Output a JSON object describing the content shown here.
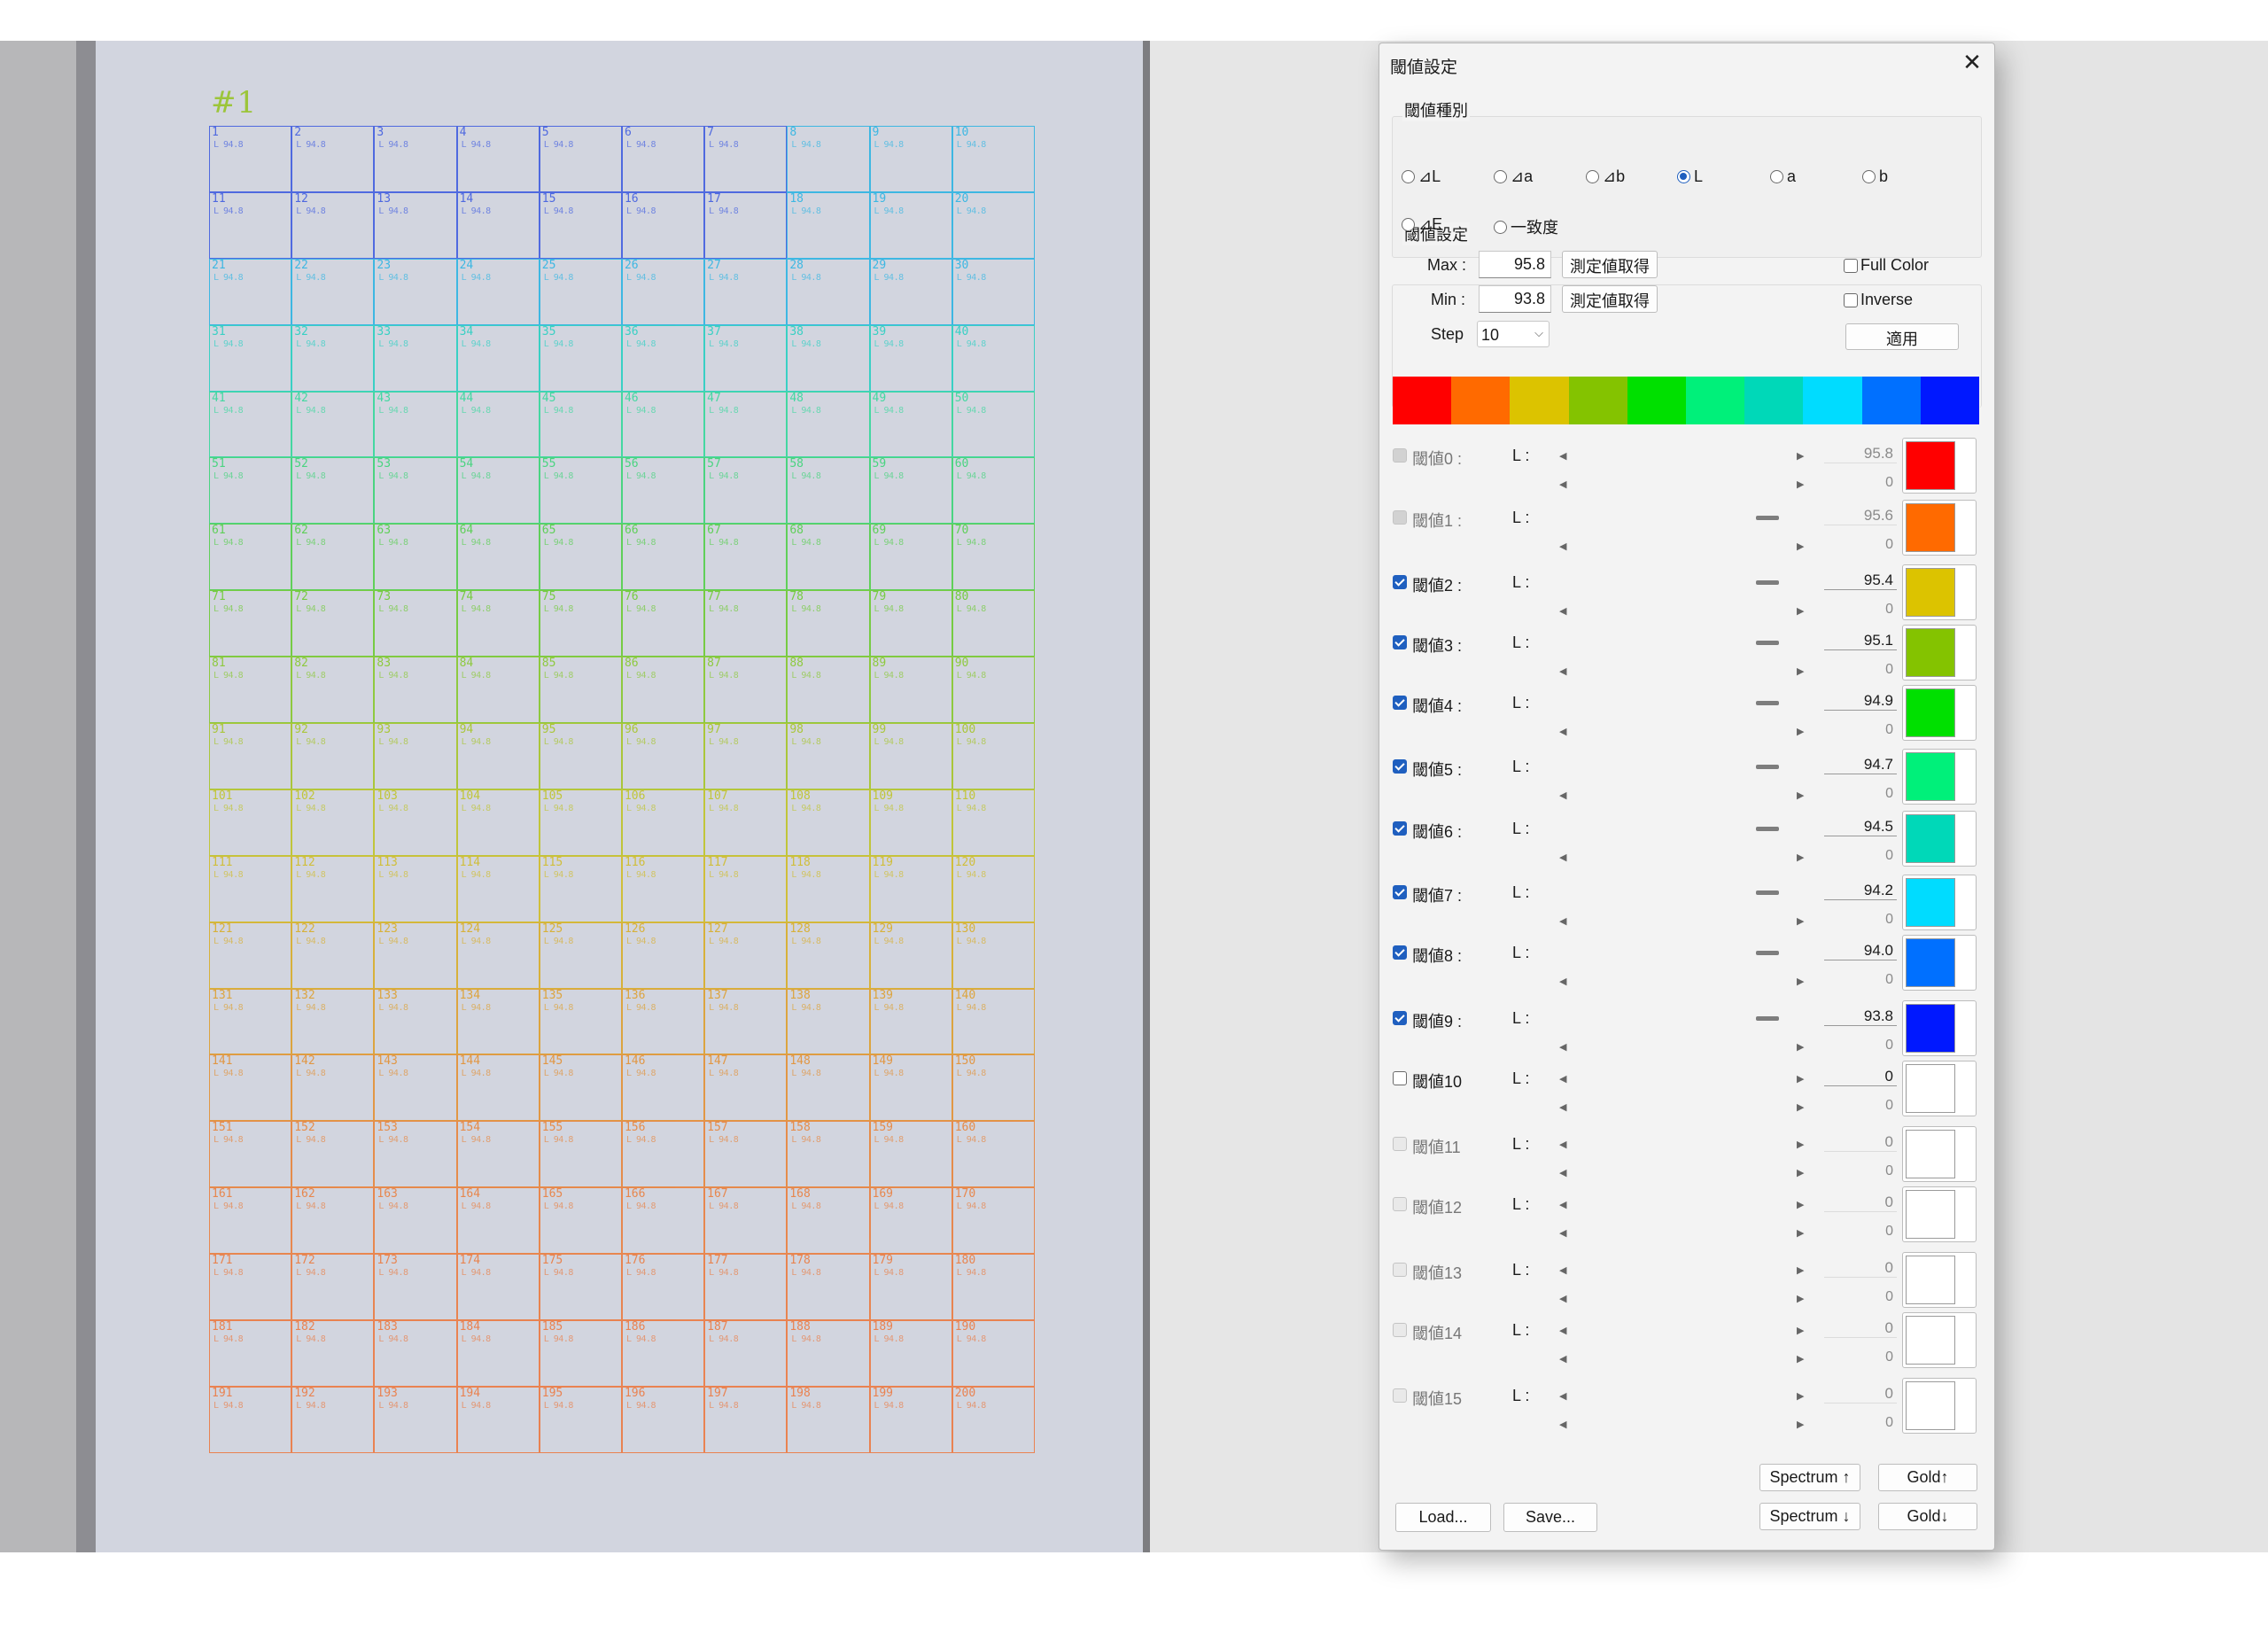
{
  "image": {
    "plate_label": "#1",
    "grid_rows": 20,
    "grid_cols": 10,
    "row_colors": [
      "#4b66e0",
      "#4b66e0",
      "#39b7e3",
      "#35d0c4",
      "#40d8a0",
      "#46d47e",
      "#5ccf55",
      "#74cb3e",
      "#8cc93a",
      "#a9c635",
      "#c0c535",
      "#d0be35",
      "#d8b035",
      "#dda33a",
      "#e29540",
      "#e68a46",
      "#e8854a",
      "#e9824c",
      "#ea804d",
      "#ea804d"
    ],
    "cell_readout": "L 94.8"
  },
  "dialog": {
    "title": "閾値設定",
    "close_icon": "✕",
    "type_group": {
      "label": "閾値種別",
      "options": [
        "⊿L",
        "⊿a",
        "⊿b",
        "L",
        "a",
        "b",
        "⊿E",
        "一致度"
      ],
      "selected": "L"
    },
    "setting_group": {
      "label": "閾値設定",
      "max_label": "Max :",
      "max_value": "95.8",
      "min_label": "Min :",
      "min_value": "93.8",
      "measure_button": "測定値取得",
      "step_label": "Step",
      "step_value": "10",
      "full_color_label": "Full Color",
      "inverse_label": "Inverse",
      "apply_button": "適用"
    },
    "spectrum_colors": [
      "#ff0000",
      "#ff6a00",
      "#dcc300",
      "#84c300",
      "#00e000",
      "#00f07a",
      "#00d8b8",
      "#00dcff",
      "#0070ff",
      "#0018ff"
    ],
    "thresholds": [
      {
        "name": "閾値0 :",
        "channel": "L :",
        "value": "95.8",
        "sub": "0",
        "color": "#ff0000",
        "state": "greyc"
      },
      {
        "name": "閾値1 :",
        "channel": "L :",
        "value": "95.6",
        "sub": "0",
        "color": "#ff6a00",
        "state": "greyc"
      },
      {
        "name": "閾値2 :",
        "channel": "L :",
        "value": "95.4",
        "sub": "0",
        "color": "#dcc300",
        "state": "checked"
      },
      {
        "name": "閾値3 :",
        "channel": "L :",
        "value": "95.1",
        "sub": "0",
        "color": "#84c300",
        "state": "checked"
      },
      {
        "name": "閾値4 :",
        "channel": "L :",
        "value": "94.9",
        "sub": "0",
        "color": "#00e000",
        "state": "checked"
      },
      {
        "name": "閾値5 :",
        "channel": "L :",
        "value": "94.7",
        "sub": "0",
        "color": "#00f07a",
        "state": "checked"
      },
      {
        "name": "閾値6 :",
        "channel": "L :",
        "value": "94.5",
        "sub": "0",
        "color": "#00d8b8",
        "state": "checked"
      },
      {
        "name": "閾値7 :",
        "channel": "L :",
        "value": "94.2",
        "sub": "0",
        "color": "#00dcff",
        "state": "checked"
      },
      {
        "name": "閾値8 :",
        "channel": "L :",
        "value": "94.0",
        "sub": "0",
        "color": "#0070ff",
        "state": "checked"
      },
      {
        "name": "閾値9 :",
        "channel": "L :",
        "value": "93.8",
        "sub": "0",
        "color": "#0018ff",
        "state": "checked"
      },
      {
        "name": "閾値10",
        "channel": "L :",
        "value": "0",
        "sub": "0",
        "color": "#ffffff",
        "state": "unchecked"
      },
      {
        "name": "閾値11",
        "channel": "L :",
        "value": "0",
        "sub": "0",
        "color": "#ffffff",
        "state": "grey"
      },
      {
        "name": "閾値12",
        "channel": "L :",
        "value": "0",
        "sub": "0",
        "color": "#ffffff",
        "state": "grey"
      },
      {
        "name": "閾値13",
        "channel": "L :",
        "value": "0",
        "sub": "0",
        "color": "#ffffff",
        "state": "grey"
      },
      {
        "name": "閾値14",
        "channel": "L :",
        "value": "0",
        "sub": "0",
        "color": "#ffffff",
        "state": "grey"
      },
      {
        "name": "閾値15",
        "channel": "L :",
        "value": "0",
        "sub": "0",
        "color": "#ffffff",
        "state": "grey"
      }
    ],
    "footer": {
      "load": "Load...",
      "save": "Save...",
      "spectrum_up": "Spectrum ↑",
      "spectrum_down": "Spectrum ↓",
      "gold_up": "Gold↑",
      "gold_down": "Gold↓"
    }
  }
}
